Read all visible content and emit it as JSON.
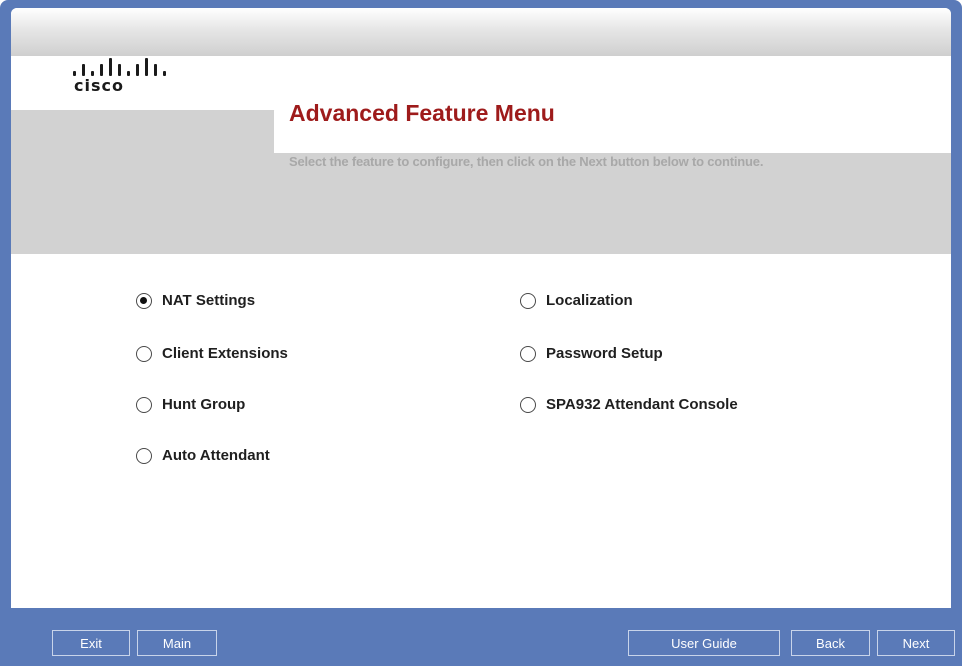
{
  "app": {
    "logo_text": "cisco"
  },
  "header": {
    "title": "Advanced Feature Menu",
    "subtitle": "Select the feature to configure, then click on the Next button below to continue."
  },
  "options": {
    "selected": "NAT Settings",
    "left": [
      {
        "label": "NAT Settings",
        "checked": true
      },
      {
        "label": "Client Extensions",
        "checked": false
      },
      {
        "label": "Hunt Group",
        "checked": false
      },
      {
        "label": "Auto Attendant",
        "checked": false
      }
    ],
    "right": [
      {
        "label": "Localization",
        "checked": false
      },
      {
        "label": "Password Setup",
        "checked": false
      },
      {
        "label": "SPA932 Attendant Console",
        "checked": false
      }
    ]
  },
  "footer": {
    "exit_label": "Exit",
    "main_label": "Main",
    "user_guide_label": "User Guide",
    "back_label": "Back",
    "next_label": "Next"
  },
  "colors": {
    "title": "#9e1b1b",
    "footer_bar": "#5a7ab8",
    "grey_band": "#d2d2d2",
    "subtitle": "#a8a8a8"
  }
}
